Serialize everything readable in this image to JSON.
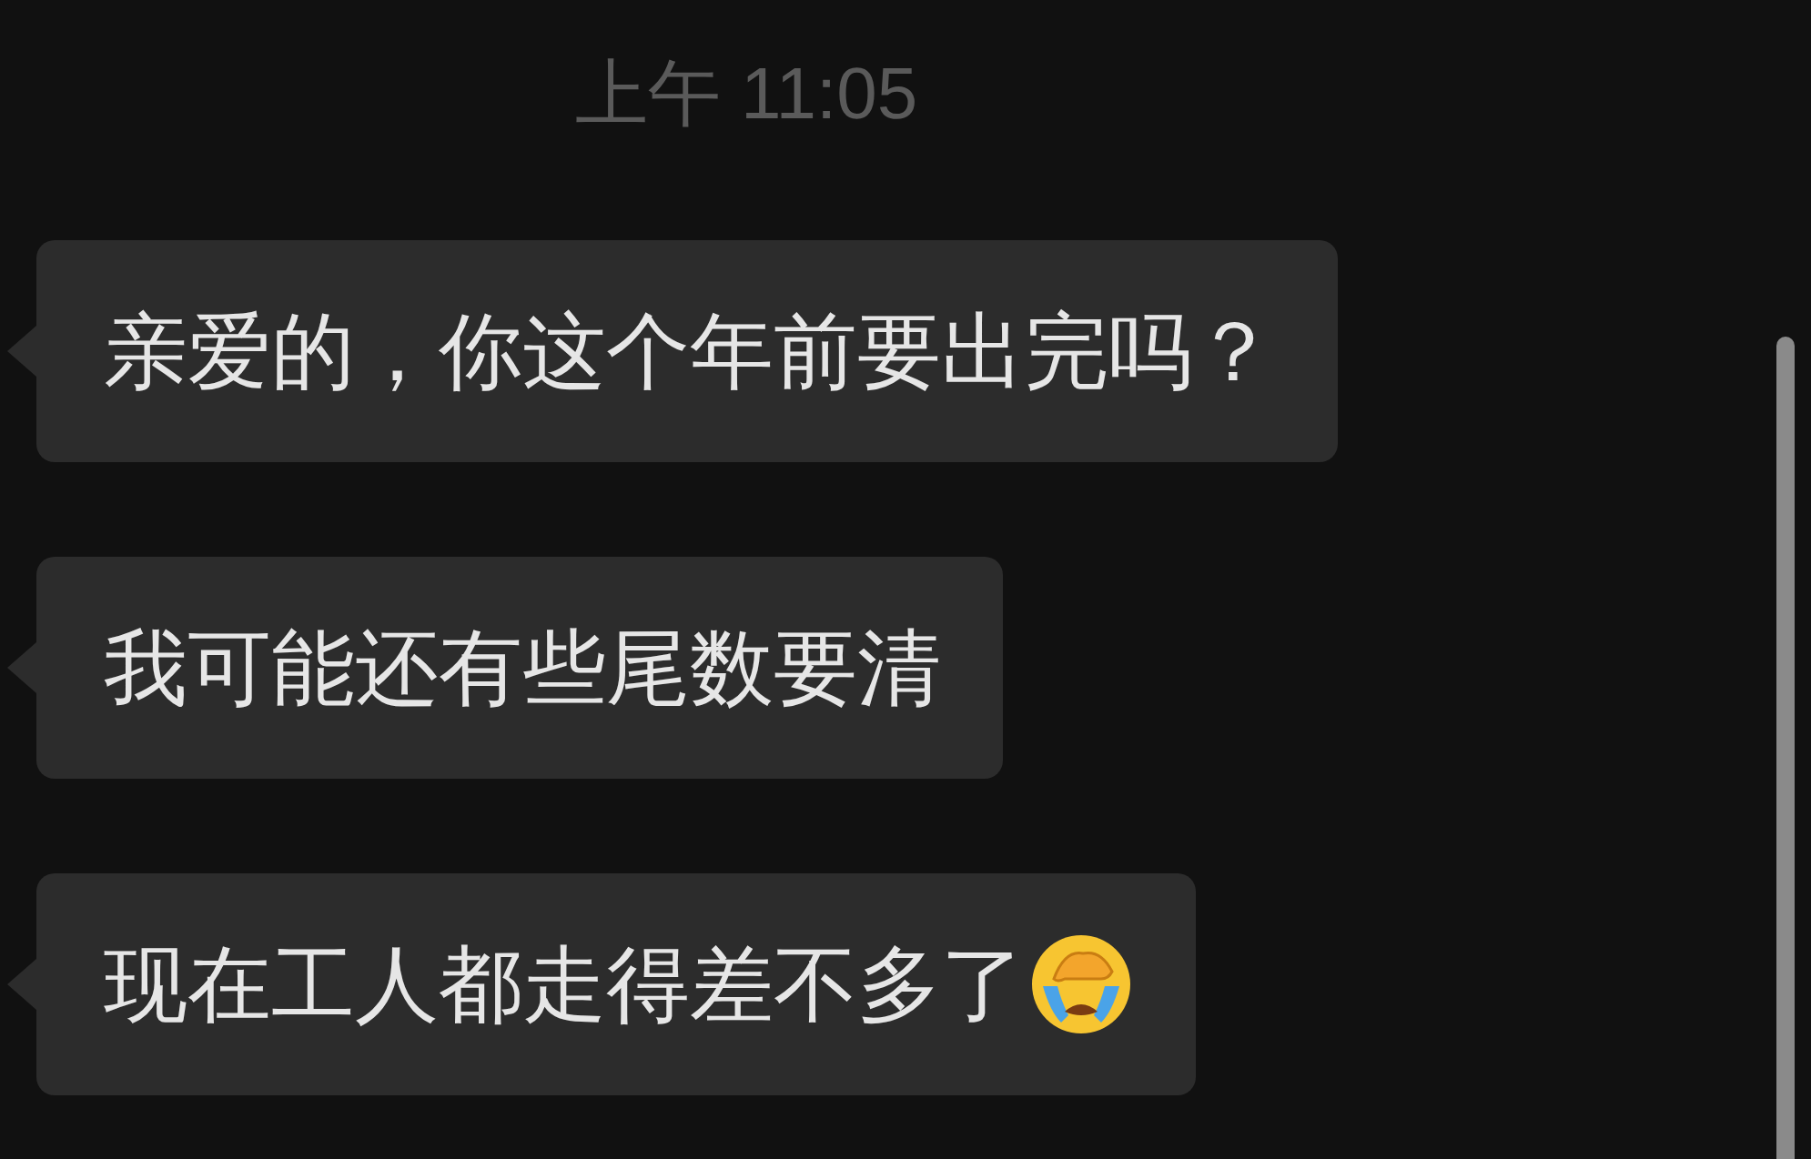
{
  "timestamp": "上午 11:05",
  "messages": [
    {
      "text": "亲爱的，你这个年前要出完吗？",
      "kind": "plain"
    },
    {
      "text": "我可能还有些尾数要清",
      "kind": "plain"
    },
    {
      "text": "现在工人都走得差不多了",
      "kind": "emoji"
    }
  ]
}
